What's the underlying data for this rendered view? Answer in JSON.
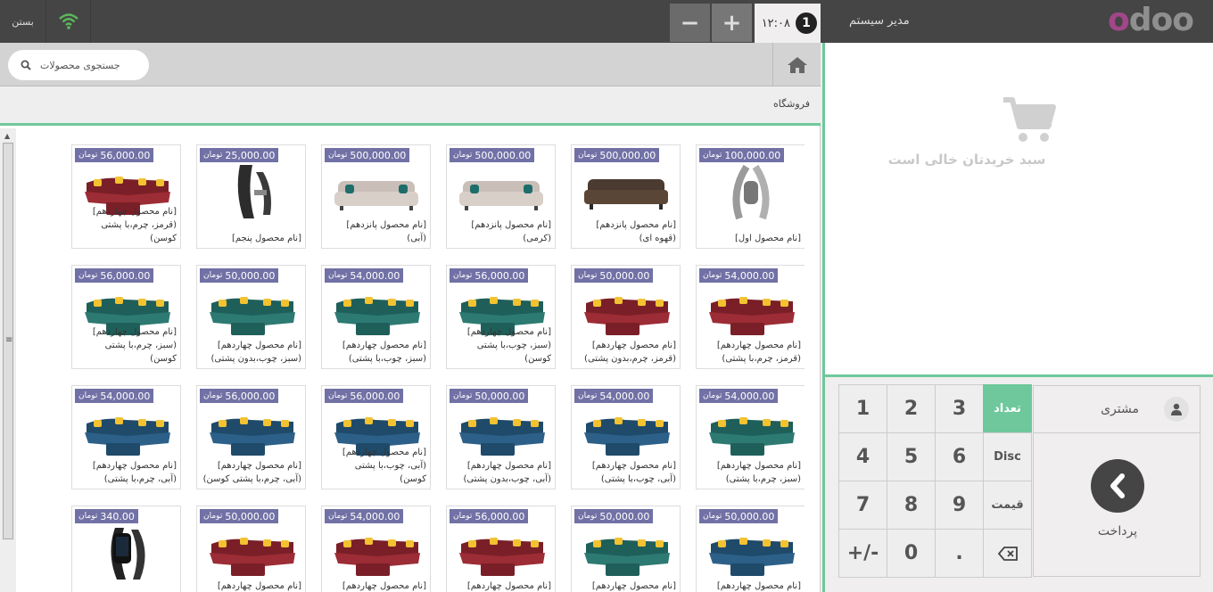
{
  "header": {
    "close_label": "بستن",
    "order_number": "1",
    "order_time": "۱۲:۰۸",
    "minus_label": "−",
    "plus_label": "+",
    "user_name": "مدیر سیستم",
    "logo_first": "o",
    "logo_rest": "doo"
  },
  "search": {
    "placeholder": "جستجوی محصولات"
  },
  "breadcrumb": {
    "label": "فروشگاه"
  },
  "cart": {
    "empty_text": "سبد خریدتان خالی است"
  },
  "numpad": {
    "keys": [
      "1",
      "2",
      "3",
      "4",
      "5",
      "6",
      "7",
      "8",
      "9",
      "+/-",
      "0",
      "."
    ],
    "mode_quantity": "تعداد",
    "mode_discount": "Disc",
    "mode_price": "قیمت"
  },
  "customer_label": "مشتری",
  "payment_label": "پرداخت",
  "colors": {
    "accent_green": "#6ec89b",
    "price_badge": "#7171a6",
    "topbar": "#454545"
  },
  "products": [
    {
      "price": "100,000.00",
      "currency": "تومان",
      "name": "[نام محصول اول]",
      "kind": "band"
    },
    {
      "price": "500,000.00",
      "currency": "تومان",
      "name": "[نام محصول پانزدهم] (قهوه ای)",
      "kind": "sofa-brown"
    },
    {
      "price": "500,000.00",
      "currency": "تومان",
      "name": "[نام محصول پانزدهم] (کرمی)",
      "kind": "sofa-cream"
    },
    {
      "price": "500,000.00",
      "currency": "تومان",
      "name": "[نام محصول پانزدهم] (آبی)",
      "kind": "sofa-cream"
    },
    {
      "price": "25,000.00",
      "currency": "تومان",
      "name": "[نام محصول پنجم]",
      "kind": "strap"
    },
    {
      "price": "56,000.00",
      "currency": "تومان",
      "name": "[نام محصول چهاردهم] (قرمز، چرم،با پشتی کوسن)",
      "kind": "l-red"
    },
    {
      "price": "54,000.00",
      "currency": "تومان",
      "name": "[نام محصول چهاردهم] (قرمز، چرم،با پشتی)",
      "kind": "l-red"
    },
    {
      "price": "50,000.00",
      "currency": "تومان",
      "name": "[نام محصول چهاردهم] (قرمز، چرم،بدون پشتی)",
      "kind": "l-red"
    },
    {
      "price": "56,000.00",
      "currency": "تومان",
      "name": "[نام محصول چهاردهم] (سبز، چوب،با پشتی کوسن)",
      "kind": "l-green"
    },
    {
      "price": "54,000.00",
      "currency": "تومان",
      "name": "[نام محصول چهاردهم] (سبز، چوب،با پشتی)",
      "kind": "l-green"
    },
    {
      "price": "50,000.00",
      "currency": "تومان",
      "name": "[نام محصول چهاردهم] (سبز، چوب،بدون پشتی)",
      "kind": "l-green"
    },
    {
      "price": "56,000.00",
      "currency": "تومان",
      "name": "[نام محصول چهاردهم] (سبز، چرم،با پشتی کوسن)",
      "kind": "l-green"
    },
    {
      "price": "54,000.00",
      "currency": "تومان",
      "name": "[نام محصول چهاردهم] (سبز، چرم،با پشتی)",
      "kind": "l-green"
    },
    {
      "price": "54,000.00",
      "currency": "تومان",
      "name": "[نام محصول چهاردهم] (آبی، چوب،با پشتی)",
      "kind": "l-blue"
    },
    {
      "price": "50,000.00",
      "currency": "تومان",
      "name": "[نام محصول چهاردهم] (آبی، چوب،بدون پشتی)",
      "kind": "l-blue"
    },
    {
      "price": "56,000.00",
      "currency": "تومان",
      "name": "[نام محصول چهاردهم] (آبی، چوب،با پشتی کوسن)",
      "kind": "l-blue"
    },
    {
      "price": "56,000.00",
      "currency": "تومان",
      "name": "[نام محصول چهاردهم] (آبی، چرم،با پشتی کوسن)",
      "kind": "l-blue"
    },
    {
      "price": "54,000.00",
      "currency": "تومان",
      "name": "[نام محصول چهاردهم] (آبی، چرم،با پشتی)",
      "kind": "l-blue"
    },
    {
      "price": "50,000.00",
      "currency": "تومان",
      "name": "[نام محصول چهاردهم] (آبی،",
      "kind": "l-blue"
    },
    {
      "price": "50,000.00",
      "currency": "تومان",
      "name": "[نام محصول چهاردهم] (سبز،",
      "kind": "l-green"
    },
    {
      "price": "56,000.00",
      "currency": "تومان",
      "name": "[نام محصول چهاردهم] (قرمز،",
      "kind": "l-red"
    },
    {
      "price": "54,000.00",
      "currency": "تومان",
      "name": "[نام محصول چهاردهم] (قرمز،",
      "kind": "l-red"
    },
    {
      "price": "50,000.00",
      "currency": "تومان",
      "name": "[نام محصول چهاردهم] (قرمز،",
      "kind": "l-red"
    },
    {
      "price": "340.00",
      "currency": "تومان",
      "name": "[نام محصول",
      "kind": "watch"
    }
  ]
}
